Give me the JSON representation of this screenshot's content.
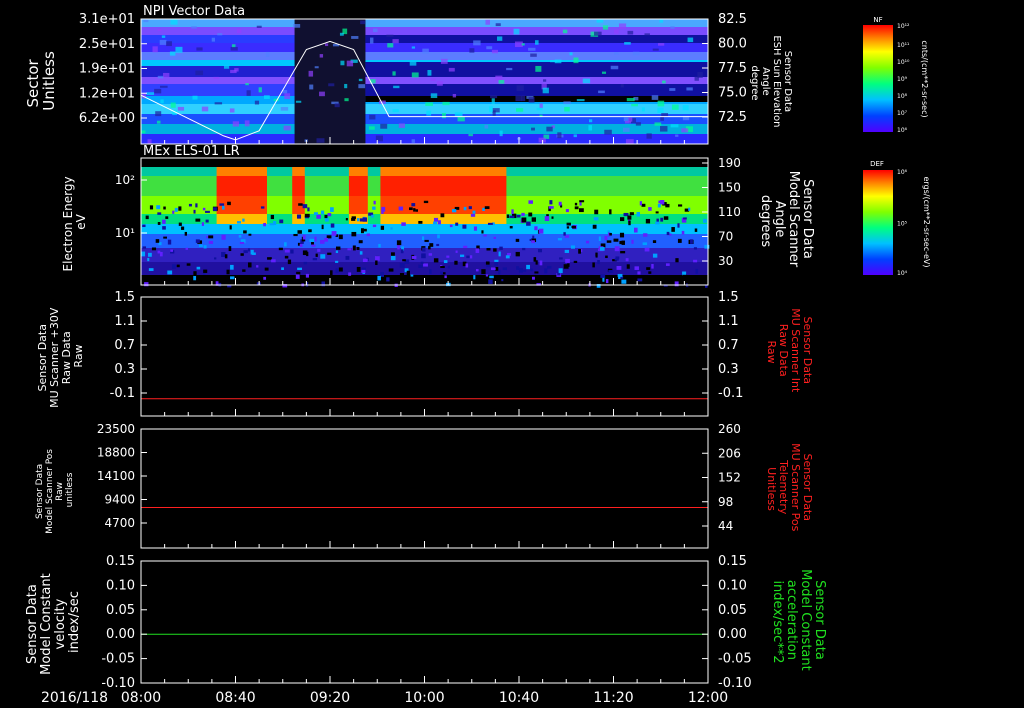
{
  "date_label": "2016/118",
  "x_ticks": [
    "08:00",
    "08:40",
    "09:20",
    "10:00",
    "10:40",
    "11:20",
    "12:00"
  ],
  "panels": {
    "npi": {
      "title": "NPI Vector Data",
      "left_label": [
        "Sector",
        "Unitless"
      ],
      "left_ticks": [
        "3.1e+01",
        "2.5e+01",
        "1.9e+01",
        "1.2e+01",
        "6.2e+00"
      ],
      "right_label": [
        "Sensor Data",
        "ESH Sun Elevation",
        "Angle",
        "degree"
      ],
      "right_ticks": [
        "82.5",
        "80.0",
        "77.5",
        "75.0",
        "72.5"
      ],
      "colorbar": {
        "tag": "NF",
        "top": "10¹²",
        "ticks": [
          "10¹¹",
          "10¹⁰",
          "10⁹",
          "10⁸",
          "10⁷",
          "10⁶"
        ],
        "unit": "cnts/(cm**2-sr-sec)"
      }
    },
    "els": {
      "title": "MEx ELS-01 LR",
      "left_label": [
        "Electron Energy",
        "eV"
      ],
      "left_ticks": [
        "10²",
        "10¹"
      ],
      "right_label": [
        "Sensor Data",
        "Model Scanner",
        "Angle",
        "degrees"
      ],
      "right_ticks": [
        "190",
        "150",
        "110",
        "70",
        "30"
      ],
      "colorbar": {
        "tag": "DEF",
        "top": "10⁶",
        "ticks": [
          "10⁵",
          "10⁴"
        ],
        "unit": "ergs/(cm**2-sr-sec-eV)"
      }
    },
    "mu_int": {
      "left_label": [
        "Sensor Data",
        "MU Scanner +30V",
        "Raw Data",
        "Raw"
      ],
      "left_ticks": [
        "1.5",
        "1.1",
        "0.7",
        "0.3",
        "-0.1"
      ],
      "right_label": [
        "Sensor Data",
        "MU Scanner Int",
        "Raw Data",
        "Raw"
      ],
      "right_ticks": [
        "1.5",
        "1.1",
        "0.7",
        "0.3",
        "-0.1"
      ]
    },
    "mu_pos": {
      "left_label": [
        "Sensor Data",
        "Model Scanner Pos",
        "Raw",
        "unitless"
      ],
      "left_ticks": [
        "23500",
        "18800",
        "14100",
        "9400",
        "4700"
      ],
      "right_label": [
        "Sensor Data",
        "MU Scanner Pos",
        "Telemetry",
        "Unitless"
      ],
      "right_ticks": [
        "260",
        "206",
        "152",
        "98",
        "44"
      ]
    },
    "model": {
      "left_label": [
        "Sensor Data",
        "Model Constant",
        "velocity",
        "index/sec"
      ],
      "left_ticks": [
        "0.15",
        "0.10",
        "0.05",
        "0.00",
        "-0.05",
        "-0.10"
      ],
      "right_label": [
        "Sensor Data",
        "Model Constant",
        "acceleration",
        "index/sec**2"
      ],
      "right_ticks": [
        "0.15",
        "0.10",
        "0.05",
        "0.00",
        "-0.05",
        "-0.10"
      ]
    }
  },
  "colors": {
    "red": "#ff2020",
    "green": "#20e020",
    "white": "#ffffff"
  },
  "chart_data": [
    {
      "type": "heatmap",
      "title": "NPI Vector Data",
      "xlim": [
        "08:00",
        "12:00"
      ],
      "ylabel": "Sector Unitless",
      "overlay_line": {
        "axis": "right",
        "ylim": [
          70.2,
          82.5
        ],
        "x": [
          "08:00",
          "08:35",
          "08:40",
          "08:50",
          "09:10",
          "09:20",
          "09:30",
          "09:45",
          "12:00"
        ],
        "y": [
          75.0,
          71.0,
          70.6,
          71.5,
          79.5,
          80.3,
          79.5,
          72.9,
          72.9
        ]
      }
    },
    {
      "type": "heatmap",
      "title": "MEx ELS-01 LR",
      "xlim": [
        "08:00",
        "12:00"
      ],
      "ylabel": "Electron Energy eV"
    },
    {
      "type": "line",
      "xlim": [
        "08:00",
        "12:00"
      ],
      "ylim": [
        -0.3,
        1.5
      ],
      "series": [
        {
          "x": [
            "08:00",
            "12:00"
          ],
          "values": [
            -0.04,
            -0.04
          ],
          "color": "#ff2020"
        }
      ]
    },
    {
      "type": "line",
      "xlim": [
        "08:00",
        "12:00"
      ],
      "ylim": [
        0,
        23500
      ],
      "series": [
        {
          "x": [
            "08:00",
            "12:00"
          ],
          "values": [
            8000,
            8000
          ],
          "color": "#ff2020"
        }
      ]
    },
    {
      "type": "line",
      "xlim": [
        "08:00",
        "12:00"
      ],
      "ylim": [
        -0.1,
        0.15
      ],
      "series": [
        {
          "x": [
            "08:00",
            "12:00"
          ],
          "values": [
            0.0,
            0.0
          ],
          "color": "#20e020"
        }
      ]
    }
  ]
}
